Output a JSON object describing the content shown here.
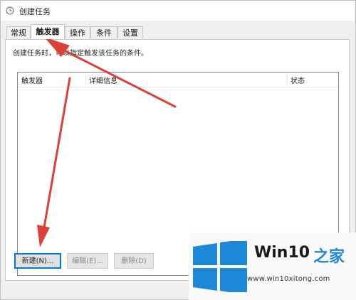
{
  "window": {
    "title": "创建任务",
    "icon": "task-clock-icon"
  },
  "tabs": [
    {
      "label": "常规",
      "active": false
    },
    {
      "label": "触发器",
      "active": true
    },
    {
      "label": "操作",
      "active": false
    },
    {
      "label": "条件",
      "active": false
    },
    {
      "label": "设置",
      "active": false
    }
  ],
  "panel": {
    "description": "创建任务时，可以指定触发该任务的条件。"
  },
  "triggers_table": {
    "columns": [
      "触发器",
      "详细信息",
      "状态"
    ],
    "rows": []
  },
  "buttons": {
    "new": "新建(N)...",
    "edit": "编辑(E)...",
    "delete": "删除(D)"
  },
  "colors": {
    "annotation_arrow": "#d9413a",
    "logo_blue": "#1e88d8"
  },
  "watermark": {
    "brand": "Win10",
    "brand_suffix": "之家",
    "url": "www.win10xitong.com"
  }
}
